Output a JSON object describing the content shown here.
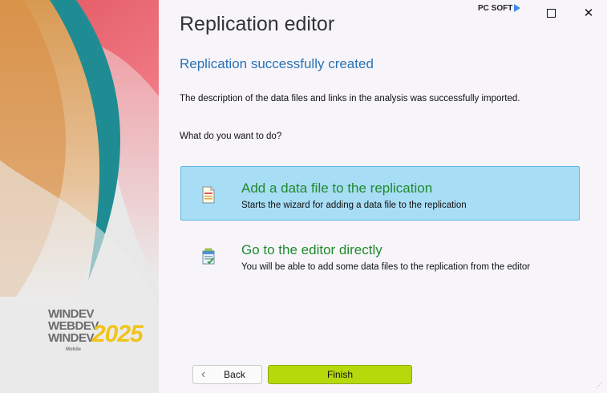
{
  "window": {
    "vendor_logo": "PC SOFT",
    "maximize_icon": "maximize-icon",
    "close_icon": "close-icon",
    "close_glyph": "✕"
  },
  "sidebar": {
    "brand_lines": [
      "WINDEV",
      "WEBDEV",
      "WINDEV"
    ],
    "brand_mobile": "Mobile",
    "brand_year": "2025",
    "colors": {
      "red": "#e8566a",
      "teal": "#1f8c93",
      "orange": "#e8a350",
      "yellow": "#f0c419"
    }
  },
  "header": {
    "title": "Replication editor",
    "subtitle": "Replication successfully created"
  },
  "main": {
    "description": "The description of the data files and links in the analysis was successfully imported.",
    "question": "What do you want to do?",
    "options": [
      {
        "title": "Add a data file to the replication",
        "subtitle": "Starts the wizard for adding a data file to the replication",
        "icon": "add-data-file-icon",
        "selected": true
      },
      {
        "title": "Go to the editor directly",
        "subtitle": "You will be able to add some data files to the replication from the editor",
        "icon": "editor-icon",
        "selected": false
      }
    ]
  },
  "footer": {
    "back_label": "Back",
    "finish_label": "Finish",
    "accent_color": "#b6d90b"
  }
}
